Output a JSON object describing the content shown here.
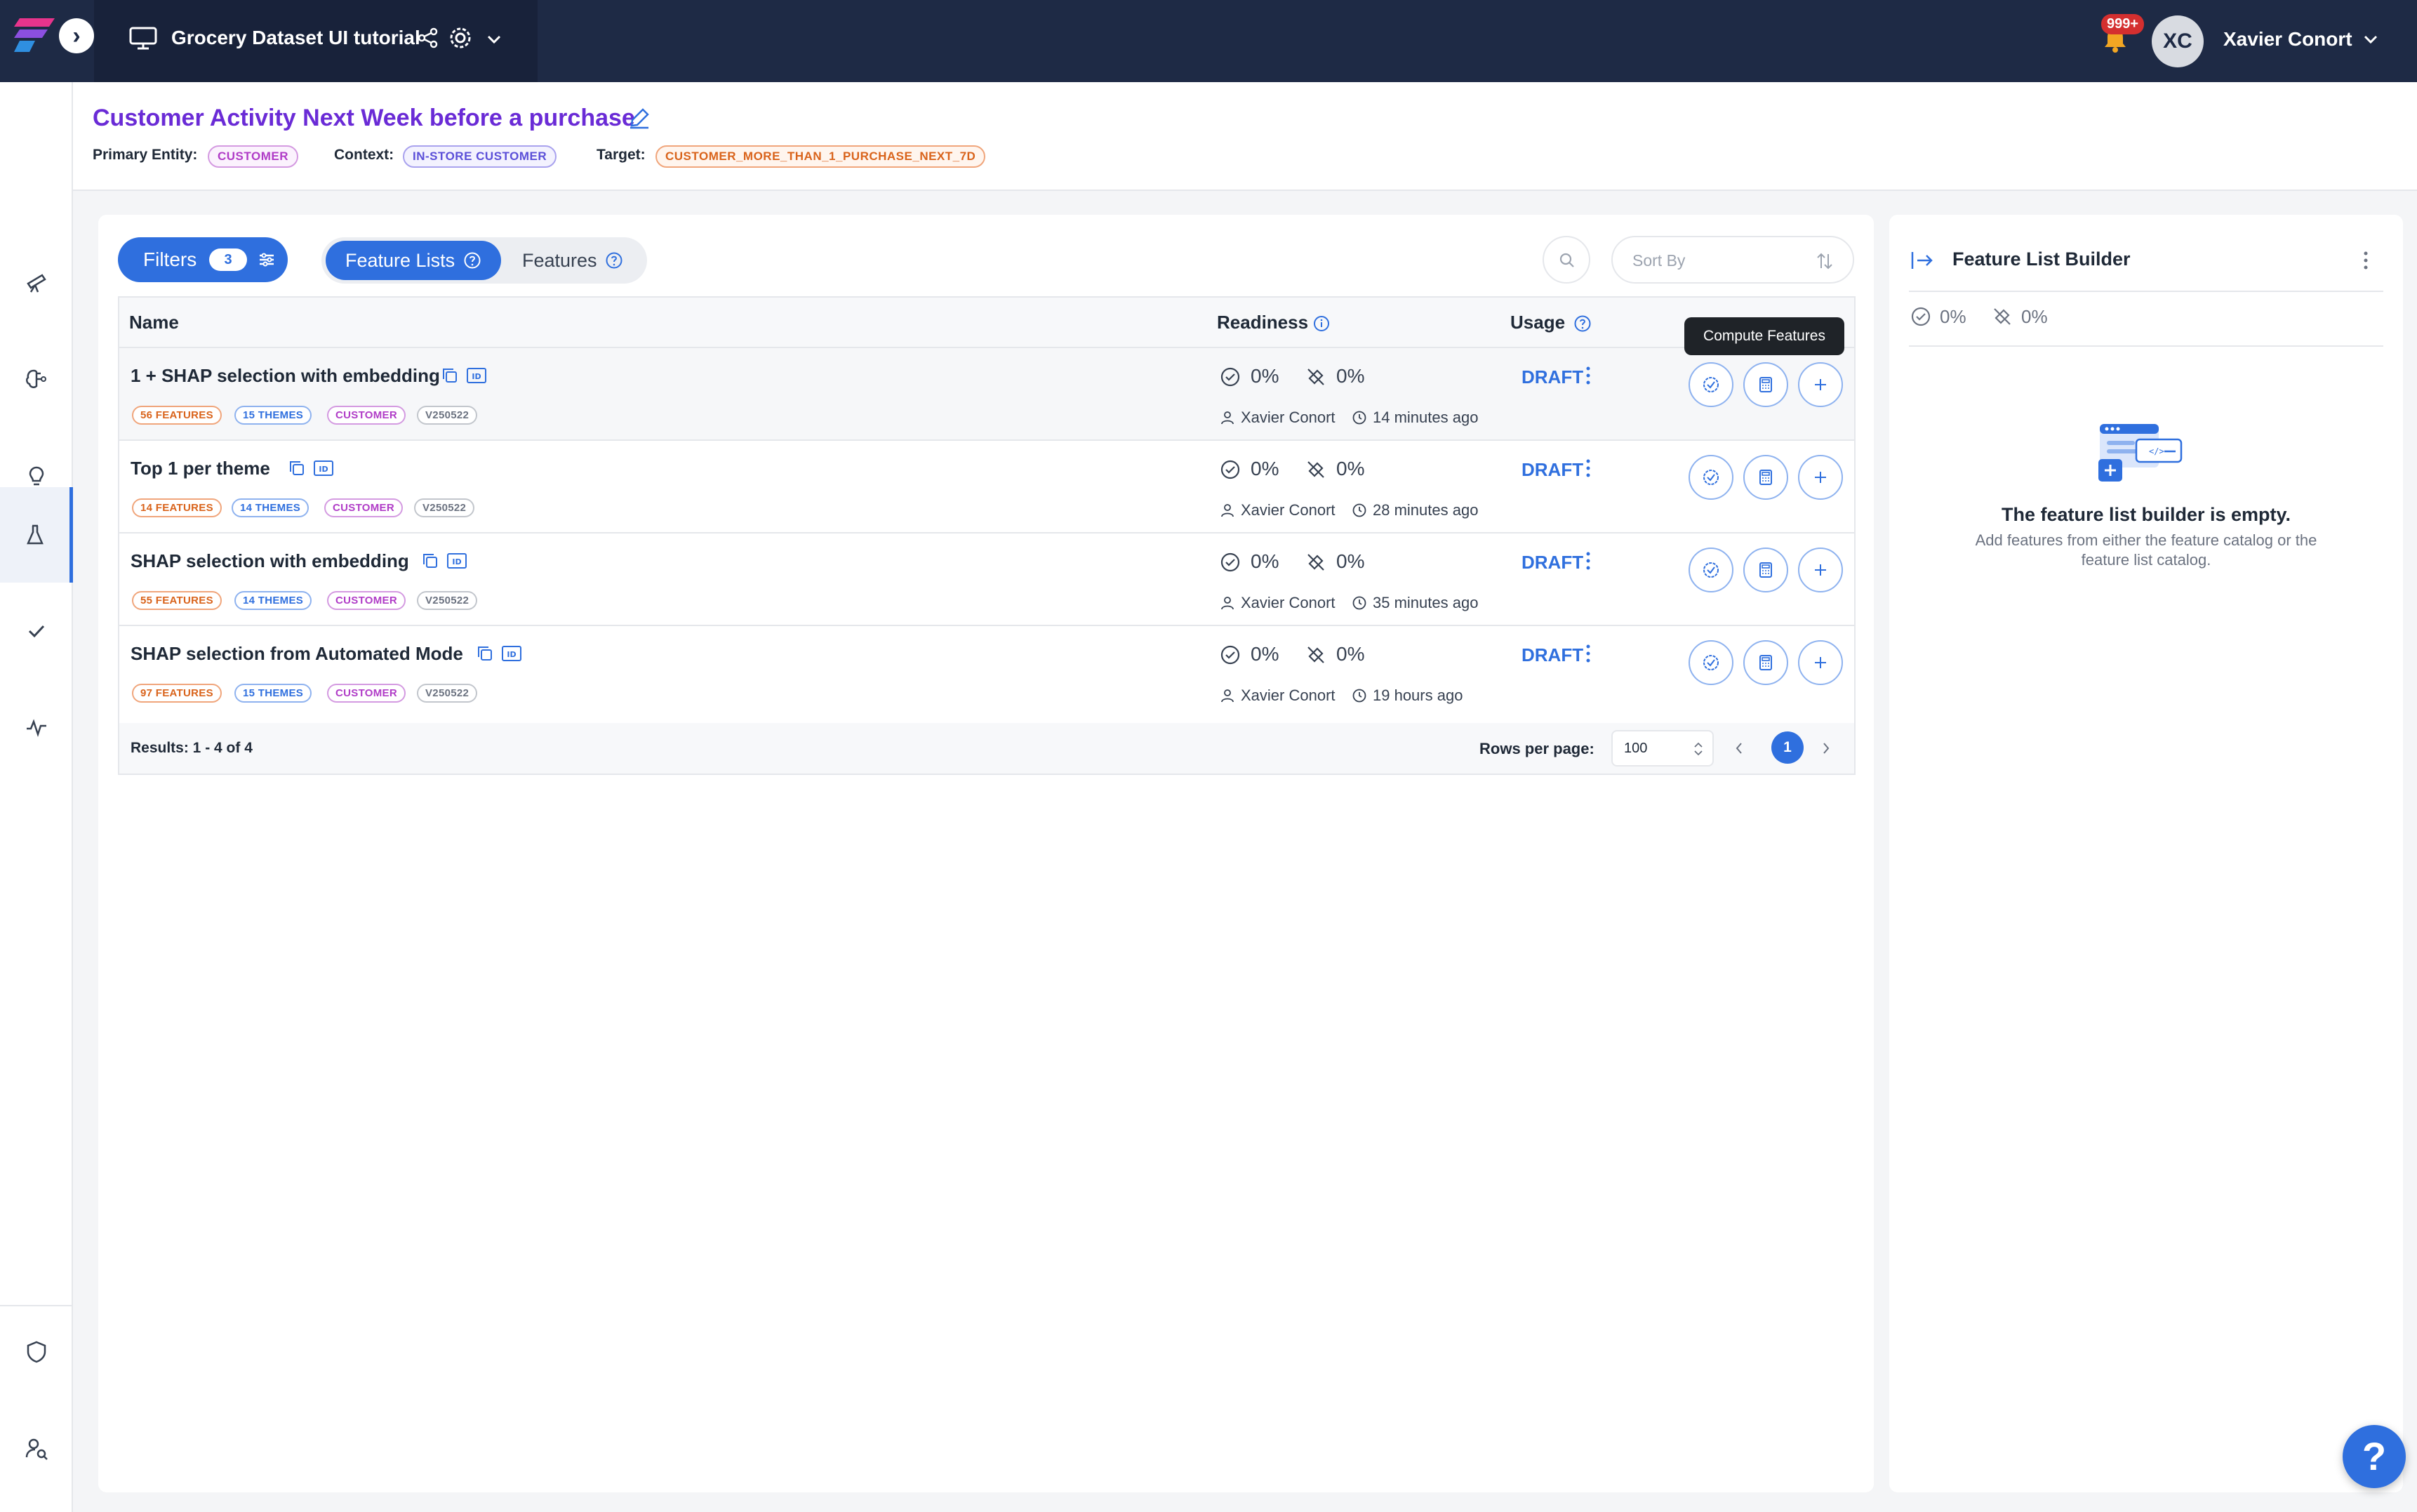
{
  "topbar": {
    "project_title": "Grocery Dataset UI tutorial",
    "notifications_badge": "999+",
    "user_initials": "XC",
    "user_name": "Xavier Conort"
  },
  "header": {
    "title": "Customer Activity Next Week before a purchase",
    "primary_entity_label": "Primary Entity:",
    "primary_entity_value": "CUSTOMER",
    "context_label": "Context:",
    "context_value": "IN-STORE CUSTOMER",
    "target_label": "Target:",
    "target_value": "CUSTOMER_MORE_THAN_1_PURCHASE_NEXT_7D"
  },
  "toolbar": {
    "filters_label": "Filters",
    "filters_count": "3",
    "tab_feature_lists": "Feature Lists",
    "tab_features": "Features",
    "sort_placeholder": "Sort By"
  },
  "table": {
    "columns": {
      "name": "Name",
      "readiness": "Readiness",
      "usage": "Usage"
    },
    "rows": [
      {
        "name": "1 + SHAP selection with embedding",
        "features": "56 FEATURES",
        "themes": "15 THEMES",
        "entity": "CUSTOMER",
        "version": "V250522",
        "readiness": "0%",
        "online": "0%",
        "owner": "Xavier Conort",
        "time": "14 minutes ago",
        "usage": "DRAFT"
      },
      {
        "name": "Top 1 per theme",
        "features": "14 FEATURES",
        "themes": "14 THEMES",
        "entity": "CUSTOMER",
        "version": "V250522",
        "readiness": "0%",
        "online": "0%",
        "owner": "Xavier Conort",
        "time": "28 minutes ago",
        "usage": "DRAFT"
      },
      {
        "name": "SHAP selection with embedding",
        "features": "55 FEATURES",
        "themes": "14 THEMES",
        "entity": "CUSTOMER",
        "version": "V250522",
        "readiness": "0%",
        "online": "0%",
        "owner": "Xavier Conort",
        "time": "35 minutes ago",
        "usage": "DRAFT"
      },
      {
        "name": "SHAP selection from Automated Mode",
        "features": "97 FEATURES",
        "themes": "15 THEMES",
        "entity": "CUSTOMER",
        "version": "V250522",
        "readiness": "0%",
        "online": "0%",
        "owner": "Xavier Conort",
        "time": "19 hours ago",
        "usage": "DRAFT"
      }
    ],
    "results_text": "Results: 1 - 4 of 4",
    "rows_per_page_label": "Rows per page:",
    "rows_per_page_value": "100",
    "current_page": "1"
  },
  "tooltip": {
    "text": "Compute Features"
  },
  "right_panel": {
    "title": "Feature List Builder",
    "readiness": "0%",
    "online": "0%",
    "empty_title": "The feature list builder is empty.",
    "empty_desc": "Add features from either the feature catalog or the feature list catalog."
  },
  "help": {
    "label": "?"
  },
  "colors": {
    "accent": "#2f6fde",
    "topbar": "#1e2a45",
    "title": "#6a2bd6"
  }
}
